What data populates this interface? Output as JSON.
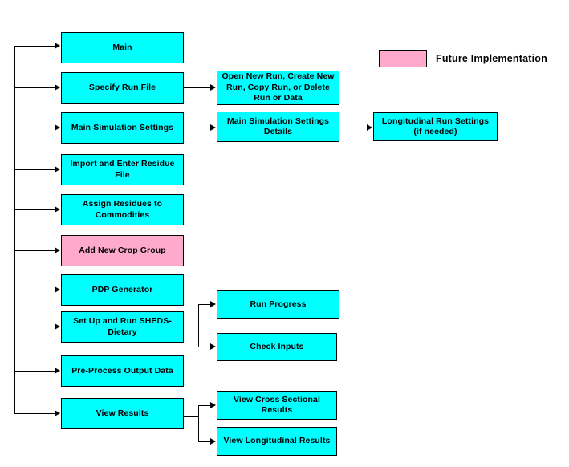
{
  "diagram": {
    "legend": {
      "swatch_color": "#ffaacc",
      "label": "Future Implementation"
    },
    "colors": {
      "node_fill": "#00ffff",
      "future_fill": "#ffaacc",
      "border": "#000000",
      "connector": "#000000"
    },
    "nodes": {
      "main": "Main",
      "specify_run_file": "Specify Run File",
      "main_simulation_settings": "Main Simulation Settings",
      "import_residue_file": "Import and Enter Residue File",
      "assign_residues": "Assign Residues to Commodities",
      "add_new_crop_group": "Add New Crop Group",
      "pdp_generator": "PDP Generator",
      "setup_run_sheds": "Set Up and Run SHEDS-Dietary",
      "preprocess_output": "Pre-Process Output Data",
      "view_results": "View Results",
      "open_new_run": "Open New Run, Create New Run, Copy Run, or Delete Run or Data",
      "main_sim_settings_details": "Main Simulation Settings Details",
      "longitudinal_run_settings": "Longitudinal Run Settings (if needed)",
      "run_progress": "Run Progress",
      "check_inputs": "Check Inputs",
      "view_cross_sectional": "View Cross Sectional Results",
      "view_longitudinal": "View Longitudinal  Results"
    }
  }
}
